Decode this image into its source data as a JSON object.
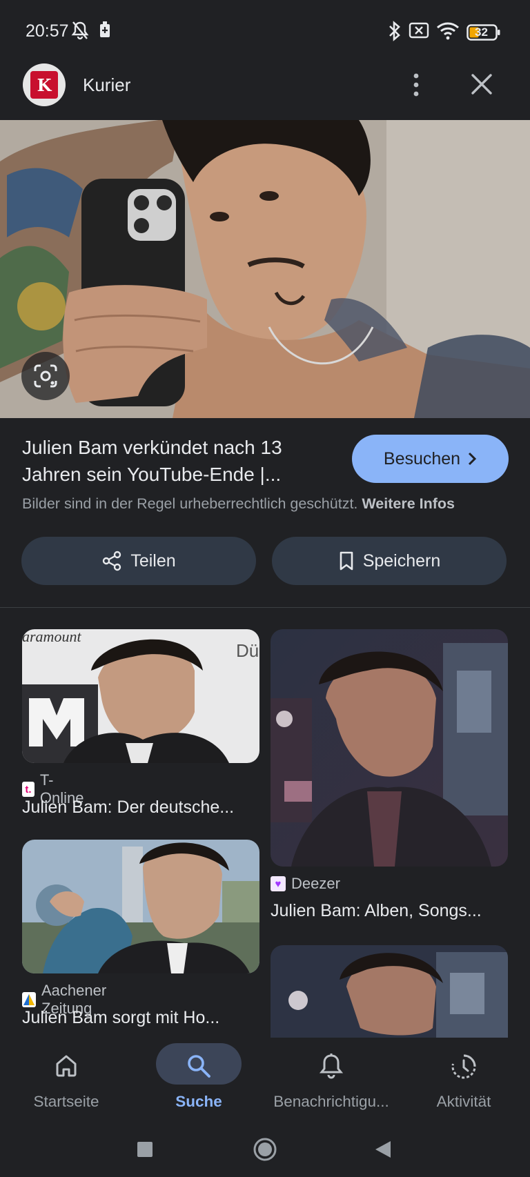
{
  "status_bar": {
    "time": "20:57",
    "battery": "32"
  },
  "header": {
    "source_name": "Kurier",
    "logo_letter": "K"
  },
  "result": {
    "title_line1": "Julien Bam verkündet nach 13",
    "title_line2": "Jahren sein YouTube-Ende |...",
    "visit_label": "Besuchen",
    "copyright_text": "Bilder sind in der Regel urheberrechtlich geschützt.",
    "copyright_link": "Weitere Infos"
  },
  "actions": {
    "share_label": "Teilen",
    "save_label": "Speichern"
  },
  "related": [
    {
      "source": "T-Online",
      "favicon_letter": "t.",
      "title": "Julien Bam: Der deutsche..."
    },
    {
      "source": "Deezer",
      "favicon_letter": "♥",
      "title": "Julien Bam: Alben, Songs..."
    },
    {
      "source": "Aachener Zeitung",
      "favicon_letter": "",
      "title": "Julien Bam sorgt mit Ho..."
    }
  ],
  "bottom_nav": [
    {
      "label": "Startseite",
      "icon": "home-icon"
    },
    {
      "label": "Suche",
      "icon": "search-icon",
      "active": true
    },
    {
      "label": "Benachrichtigu...",
      "icon": "bell-icon"
    },
    {
      "label": "Aktivität",
      "icon": "activity-icon"
    }
  ],
  "colors": {
    "background": "#202124",
    "accent": "#8ab4f8",
    "pill_bg": "#303946",
    "kurier_red": "#c8102e"
  }
}
